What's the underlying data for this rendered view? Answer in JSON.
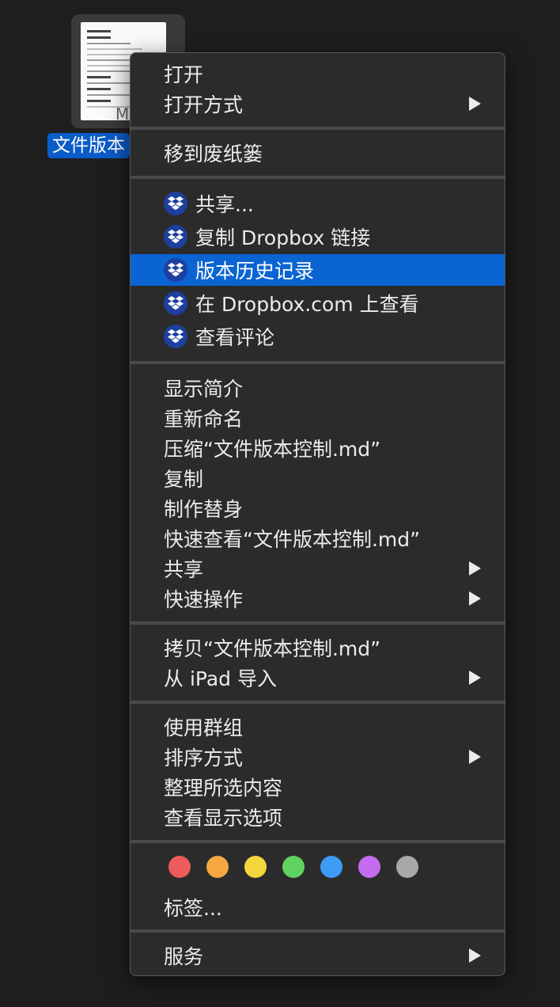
{
  "desktop": {
    "file_label": "文件版本",
    "file_doc_mark": "M"
  },
  "menu": {
    "group1": [
      {
        "label": "打开",
        "submenu": false
      },
      {
        "label": "打开方式",
        "submenu": true
      }
    ],
    "group2": [
      {
        "label": "移到废纸篓",
        "submenu": false
      }
    ],
    "group3": [
      {
        "label": "共享...",
        "icon": "dropbox-icon"
      },
      {
        "label": "复制 Dropbox 链接",
        "icon": "dropbox-icon"
      },
      {
        "label": "版本历史记录",
        "icon": "dropbox-icon",
        "highlighted": true
      },
      {
        "label": "在 Dropbox.com 上查看",
        "icon": "dropbox-icon"
      },
      {
        "label": "查看评论",
        "icon": "dropbox-icon"
      }
    ],
    "group4": [
      {
        "label": "显示简介",
        "submenu": false
      },
      {
        "label": "重新命名",
        "submenu": false
      },
      {
        "label": "压缩“文件版本控制.md”",
        "submenu": false
      },
      {
        "label": "复制",
        "submenu": false
      },
      {
        "label": "制作替身",
        "submenu": false
      },
      {
        "label": "快速查看“文件版本控制.md”",
        "submenu": false
      },
      {
        "label": "共享",
        "submenu": true
      },
      {
        "label": "快速操作",
        "submenu": true
      }
    ],
    "group5": [
      {
        "label": "拷贝“文件版本控制.md”",
        "submenu": false
      },
      {
        "label": "从 iPad 导入",
        "submenu": true
      }
    ],
    "group6": [
      {
        "label": "使用群组",
        "submenu": false
      },
      {
        "label": "排序方式",
        "submenu": true
      },
      {
        "label": "整理所选内容",
        "submenu": false
      },
      {
        "label": "查看显示选项",
        "submenu": false
      }
    ],
    "tags": {
      "colors": [
        "#ef5a5a",
        "#f5a741",
        "#f5d63c",
        "#5fd35f",
        "#3b9bf5",
        "#c46cf0",
        "#a8a8a8"
      ],
      "label": "标签..."
    },
    "group8": [
      {
        "label": "服务",
        "submenu": true
      }
    ]
  }
}
